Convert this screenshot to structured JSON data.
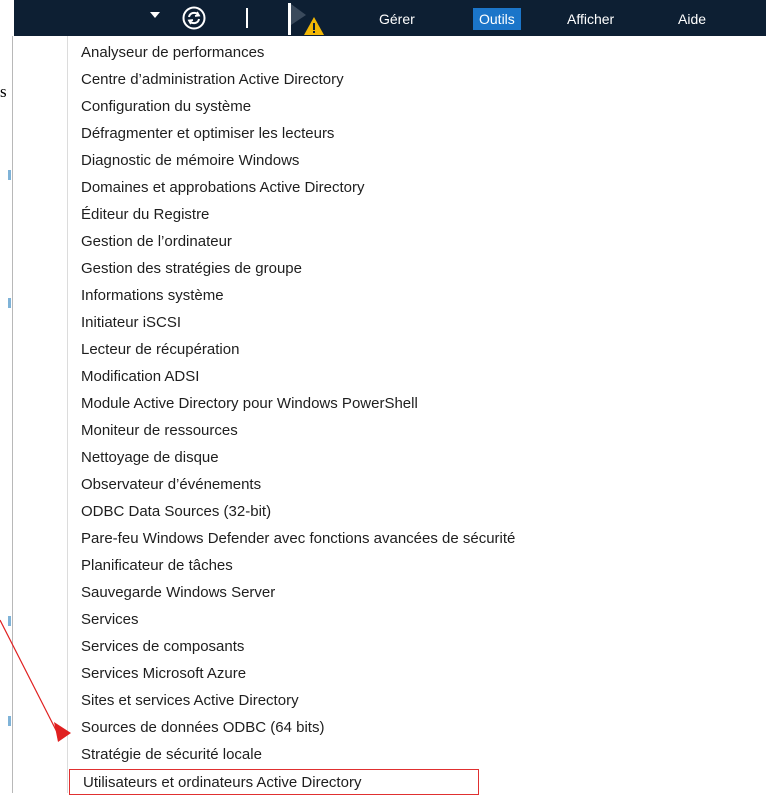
{
  "toolbar": {
    "menu": [
      {
        "label": "Gérer",
        "active": false
      },
      {
        "label": "Outils",
        "active": true
      },
      {
        "label": "Afficher",
        "active": false
      },
      {
        "label": "Aide",
        "active": false
      }
    ]
  },
  "left_panel": {
    "fragment": "s"
  },
  "tools_menu": {
    "items": [
      "Analyseur de performances",
      "Centre d’administration Active Directory",
      "Configuration du système",
      "Défragmenter et optimiser les lecteurs",
      "Diagnostic de mémoire Windows",
      "Domaines et approbations Active Directory",
      "Éditeur du Registre",
      "Gestion de l’ordinateur",
      "Gestion des stratégies de groupe",
      "Informations système",
      "Initiateur iSCSI",
      "Lecteur de récupération",
      "Modification ADSI",
      "Module Active Directory pour Windows PowerShell",
      "Moniteur de ressources",
      "Nettoyage de disque",
      "Observateur d’événements",
      "ODBC Data Sources (32-bit)",
      "Pare-feu Windows Defender avec fonctions avancées de sécurité",
      "Planificateur de tâches",
      "Sauvegarde Windows Server",
      "Services",
      "Services de composants",
      "Services Microsoft Azure",
      "Sites et services Active Directory",
      "Sources de données ODBC (64 bits)",
      "Stratégie de sécurité locale",
      "Utilisateurs et ordinateurs Active Directory"
    ],
    "highlighted_item": "Utilisateurs et ordinateurs Active Directory"
  },
  "colors": {
    "toolbar_bg": "#0d1f33",
    "active_menu_bg": "#1b75c9",
    "highlight_border": "#e03030",
    "annotation_arrow": "#e02020",
    "warning_yellow": "#f2b705"
  }
}
